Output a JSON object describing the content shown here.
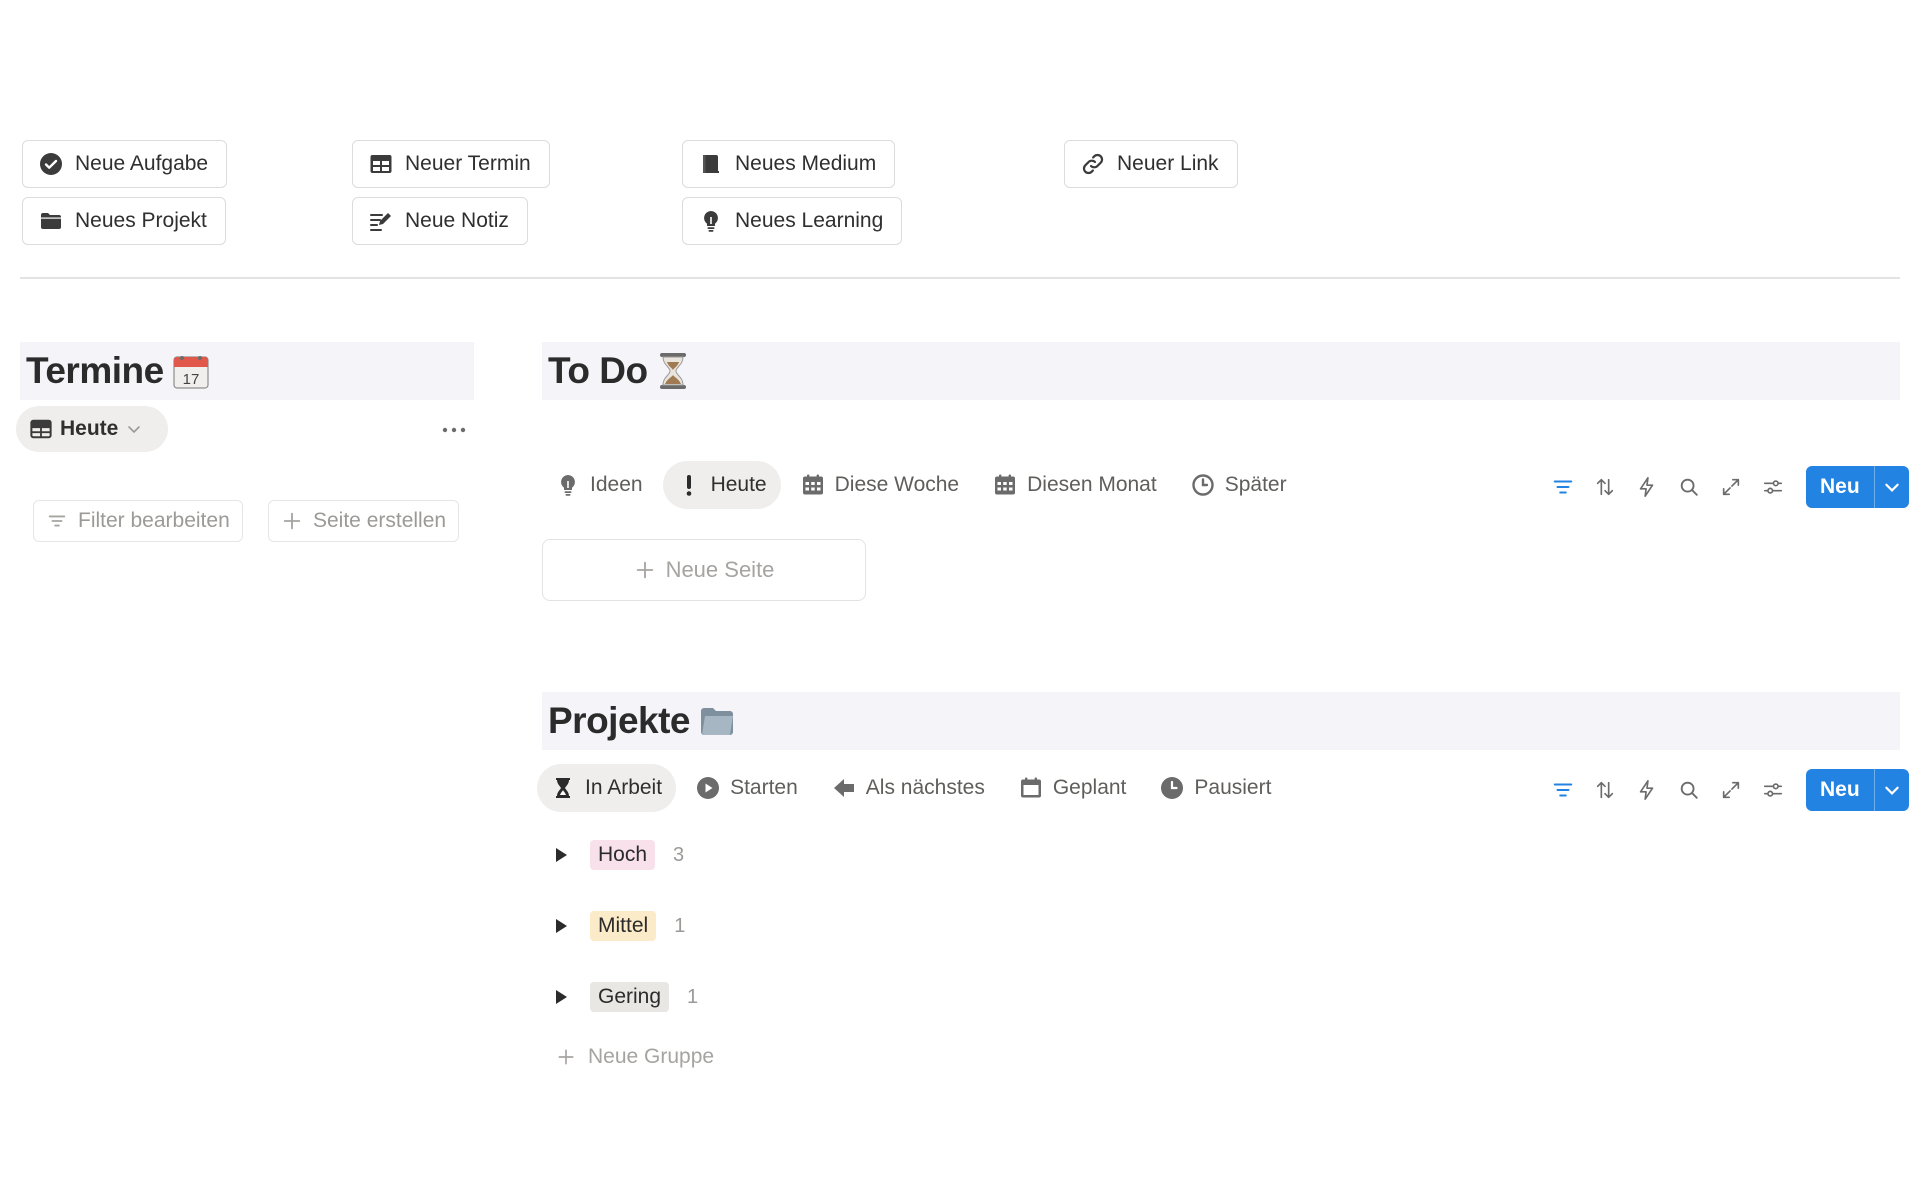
{
  "quick_actions": {
    "neue_aufgabe": "Neue Aufgabe",
    "neuer_termin": "Neuer Termin",
    "neues_medium": "Neues Medium",
    "neuer_link": "Neuer Link",
    "neues_projekt": "Neues Projekt",
    "neue_notiz": "Neue Notiz",
    "neues_learning": "Neues Learning"
  },
  "termine": {
    "title": "Termine",
    "title_emoji": "calendar-17-icon",
    "view_label": "Heute",
    "filter_label": "Filter bearbeiten",
    "create_label": "Seite erstellen"
  },
  "todo": {
    "title": "To Do",
    "title_emoji": "hourglass-icon",
    "tabs": [
      {
        "label": "Ideen",
        "icon": "lightbulb-icon"
      },
      {
        "label": "Heute",
        "icon": "exclamation-icon",
        "active": true
      },
      {
        "label": "Diese Woche",
        "icon": "calendar-grid-icon"
      },
      {
        "label": "Diesen Monat",
        "icon": "calendar-grid-icon"
      },
      {
        "label": "Später",
        "icon": "clock-icon"
      }
    ],
    "new_button": "Neu",
    "new_page": "Neue Seite"
  },
  "projekte": {
    "title": "Projekte",
    "title_emoji": "folder-icon",
    "tabs": [
      {
        "label": "In Arbeit",
        "icon": "hourglass-icon",
        "active": true
      },
      {
        "label": "Starten",
        "icon": "play-icon"
      },
      {
        "label": "Als nächstes",
        "icon": "arrow-left-icon"
      },
      {
        "label": "Geplant",
        "icon": "calendar-icon"
      },
      {
        "label": "Pausiert",
        "icon": "clock-icon"
      }
    ],
    "new_button": "Neu",
    "groups": [
      {
        "label": "Hoch",
        "count": "3",
        "color": "#f9e1ec"
      },
      {
        "label": "Mittel",
        "count": "1",
        "color": "#fbebc9"
      },
      {
        "label": "Gering",
        "count": "1",
        "color": "#e8e7e4"
      }
    ],
    "new_group": "Neue Gruppe"
  },
  "colors": {
    "accent": "#2383e2",
    "header_bg": "#f5f4f9"
  }
}
